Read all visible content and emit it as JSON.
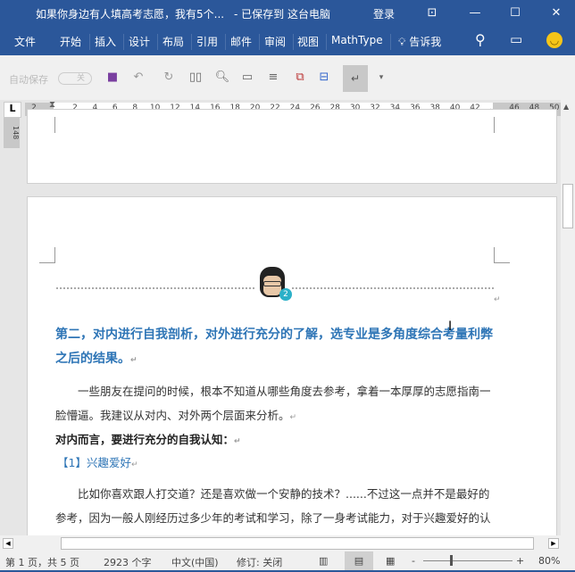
{
  "titlebar": {
    "doc_title": "如果你身边有人填高考志愿，我有5个...",
    "save_status": "- 已保存到 这台电脑",
    "login": "登录"
  },
  "ribbon": {
    "tabs": [
      "文件",
      "开始",
      "插入",
      "设计",
      "布局",
      "引用",
      "邮件",
      "审阅",
      "视图",
      "MathType"
    ],
    "tell_me": "告诉我"
  },
  "qat": {
    "autosave_label": "自动保存",
    "autosave_state": "关"
  },
  "ruler": {
    "left_margin_label": "2",
    "ticks": [
      "2",
      "4",
      "6",
      "8",
      "10",
      "12",
      "14",
      "16",
      "18",
      "20",
      "22",
      "24",
      "26",
      "28",
      "30",
      "32",
      "34",
      "36",
      "38",
      "40",
      "42"
    ],
    "right_ticks": [
      "46",
      "48",
      "50"
    ]
  },
  "vertical_ruler": {
    "label": "148"
  },
  "document": {
    "heading": "第二，对内进行自我剖析，对外进行充分的了解，选专业是多角度综合考量利弊之后的结果。",
    "para1": "一些朋友在提问的时候，根本不知道从哪些角度去参考，拿着一本厚厚的志愿指南一脸懵逼。我建议从对内、对外两个层面来分析。",
    "bold_line": "对内而言，要进行充分的自我认知：",
    "sub_heading": "【1】兴趣爱好",
    "para2": "比如你喜欢跟人打交道？还是喜欢做一个安静的技术？......不过这一点并不是最好的参考，因为一般人刚经历过多少年的考试和学习，除了一身考试能力，对于兴趣爱好的认",
    "avatar_badge": "2",
    "para_mark": "↵"
  },
  "status": {
    "page": "第 1 页，共 5 页",
    "words": "2923 个字",
    "language": "中文(中国)",
    "track": "修订: 关闭",
    "zoom": "80%",
    "zoom_level_percent": 80
  },
  "colors": {
    "brand": "#2b579a",
    "heading": "#2e75b6"
  }
}
